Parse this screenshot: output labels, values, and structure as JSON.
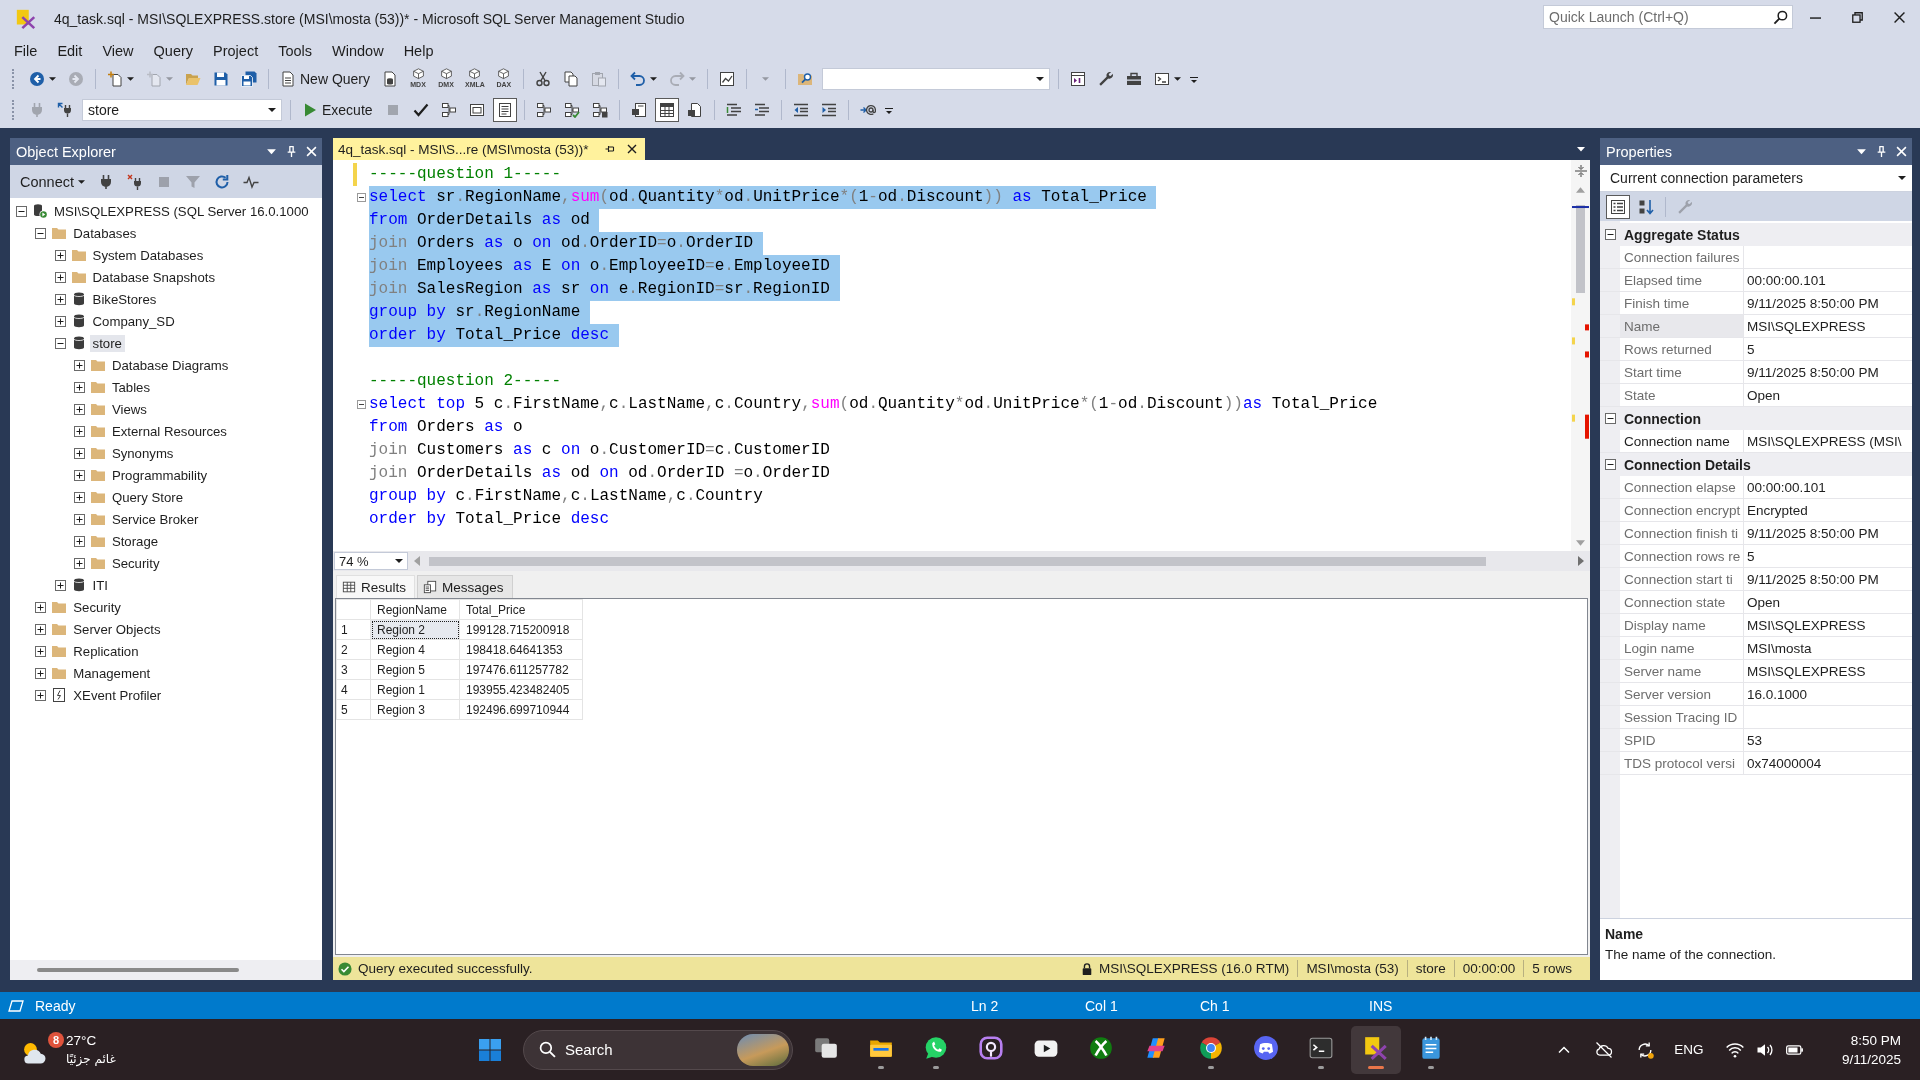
{
  "window": {
    "title": "4q_task.sql - MSI\\SQLEXPRESS.store (MSI\\mosta (53))* - Microsoft SQL Server Management Studio",
    "quick_launch": {
      "placeholder": "Quick Launch (Ctrl+Q)"
    }
  },
  "menu": [
    "File",
    "Edit",
    "View",
    "Query",
    "Project",
    "Tools",
    "Window",
    "Help"
  ],
  "toolbars": [
    {
      "items": [
        {
          "kind": "back",
          "disabled": false,
          "dropdown": true
        },
        {
          "kind": "forward",
          "disabled": true
        },
        {
          "kind": "separator"
        },
        {
          "kind": "newproject",
          "disabled": false,
          "dropdown": true
        },
        {
          "kind": "additem",
          "disabled": true,
          "dropdown": true
        },
        {
          "kind": "open",
          "disabled": false
        },
        {
          "kind": "save",
          "disabled": false
        },
        {
          "kind": "saveall",
          "disabled": false
        },
        {
          "kind": "separator"
        },
        {
          "kind": "newquery",
          "label": "New Query",
          "disabled": false
        },
        {
          "kind": "dbquery",
          "disabled": false
        },
        {
          "kind": "cubequery",
          "label": "MDX",
          "disabled": false
        },
        {
          "kind": "cubequery",
          "label": "DMX",
          "disabled": false
        },
        {
          "kind": "cubequery",
          "label": "XMLA",
          "disabled": false
        },
        {
          "kind": "cubequery",
          "label": "DAX",
          "disabled": false
        },
        {
          "kind": "separator"
        },
        {
          "kind": "cut",
          "disabled": false
        },
        {
          "kind": "copy",
          "disabled": false
        },
        {
          "kind": "paste",
          "disabled": true
        },
        {
          "kind": "separator"
        },
        {
          "kind": "undo",
          "disabled": false,
          "dropdown": true
        },
        {
          "kind": "redo",
          "disabled": true,
          "dropdown": true
        },
        {
          "kind": "separator"
        },
        {
          "kind": "monitor",
          "disabled": false
        },
        {
          "kind": "separator"
        },
        {
          "kind": "menu",
          "disabled": true,
          "dropdown": true
        },
        {
          "kind": "separator"
        },
        {
          "kind": "find",
          "disabled": false
        },
        {
          "kind": "combo"
        },
        {
          "kind": "separator"
        },
        {
          "kind": "solution",
          "disabled": false
        },
        {
          "kind": "wrench",
          "disabled": false
        },
        {
          "kind": "toolbox",
          "disabled": false
        },
        {
          "kind": "terminal",
          "disabled": false,
          "dropdown": true
        }
      ]
    },
    {
      "items": [
        {
          "kind": "plug",
          "disabled": true
        },
        {
          "kind": "connect",
          "disabled": false
        },
        {
          "kind": "combo",
          "value": "store"
        },
        {
          "kind": "separator"
        },
        {
          "kind": "execute",
          "label": "Execute",
          "disabled": false
        },
        {
          "kind": "stop",
          "disabled": true
        },
        {
          "kind": "parse",
          "disabled": false
        },
        {
          "kind": "boxes",
          "disabled": false,
          "pressed": false
        },
        {
          "kind": "window",
          "disabled": false,
          "pressed": false
        },
        {
          "kind": "page",
          "disabled": false,
          "pressed": true
        },
        {
          "kind": "separator"
        },
        {
          "kind": "boxes",
          "disabled": false,
          "pressed": false
        },
        {
          "kind": "boxescheck",
          "disabled": false,
          "pressed": false
        },
        {
          "kind": "boxesdoc",
          "disabled": false,
          "pressed": false
        },
        {
          "kind": "separator"
        },
        {
          "kind": "textdoc",
          "disabled": false,
          "pressed": false
        },
        {
          "kind": "grid",
          "disabled": false,
          "pressed": true
        },
        {
          "kind": "filedoc",
          "disabled": false,
          "pressed": false
        },
        {
          "kind": "separator"
        },
        {
          "kind": "lines",
          "disabled": false
        },
        {
          "kind": "lines2",
          "disabled": false
        },
        {
          "kind": "separator"
        },
        {
          "kind": "outdent",
          "disabled": false
        },
        {
          "kind": "indent",
          "disabled": false
        },
        {
          "kind": "separator"
        },
        {
          "kind": "at",
          "disabled": false
        }
      ]
    }
  ],
  "object_explorer": {
    "title": "Object Explorer",
    "toolbar": [
      {
        "kind": "connectmenu",
        "label": "Connect",
        "disabled": false,
        "dropdown": true
      },
      {
        "kind": "plug",
        "disabled": false
      },
      {
        "kind": "disconnect",
        "disabled": false
      },
      {
        "kind": "stop",
        "disabled": true
      },
      {
        "kind": "filter",
        "disabled": true
      },
      {
        "kind": "refresh",
        "disabled": false
      },
      {
        "kind": "pulse",
        "disabled": false
      }
    ],
    "tree": [
      {
        "label": "MSI\\SQLEXPRESS (SQL Server 16.0.1000",
        "kind": "server",
        "expanded": true,
        "selected": false,
        "children": [
          {
            "label": "Databases",
            "kind": "folder",
            "expanded": true,
            "selected": false,
            "children": [
              {
                "label": "System Databases",
                "kind": "folder",
                "expanded": false,
                "selected": false
              },
              {
                "label": "Database Snapshots",
                "kind": "folder",
                "expanded": false,
                "selected": false
              },
              {
                "label": "BikeStores",
                "kind": "database",
                "expanded": false,
                "selected": false
              },
              {
                "label": "Company_SD",
                "kind": "database",
                "expanded": false,
                "selected": false
              },
              {
                "label": "store",
                "kind": "database",
                "expanded": true,
                "selected": true,
                "children": [
                  {
                    "label": "Database Diagrams",
                    "kind": "folder",
                    "expanded": false,
                    "selected": false
                  },
                  {
                    "label": "Tables",
                    "kind": "folder",
                    "expanded": false,
                    "selected": false
                  },
                  {
                    "label": "Views",
                    "kind": "folder",
                    "expanded": false,
                    "selected": false
                  },
                  {
                    "label": "External Resources",
                    "kind": "folder",
                    "expanded": false,
                    "selected": false
                  },
                  {
                    "label": "Synonyms",
                    "kind": "folder",
                    "expanded": false,
                    "selected": false
                  },
                  {
                    "label": "Programmability",
                    "kind": "folder",
                    "expanded": false,
                    "selected": false
                  },
                  {
                    "label": "Query Store",
                    "kind": "folder",
                    "expanded": false,
                    "selected": false
                  },
                  {
                    "label": "Service Broker",
                    "kind": "folder",
                    "expanded": false,
                    "selected": false
                  },
                  {
                    "label": "Storage",
                    "kind": "folder",
                    "expanded": false,
                    "selected": false
                  },
                  {
                    "label": "Security",
                    "kind": "folder",
                    "expanded": false,
                    "selected": false
                  }
                ]
              },
              {
                "label": "ITI",
                "kind": "database",
                "expanded": false,
                "selected": false
              }
            ]
          },
          {
            "label": "Security",
            "kind": "folder",
            "expanded": false,
            "selected": false
          },
          {
            "label": "Server Objects",
            "kind": "folder",
            "expanded": false,
            "selected": false
          },
          {
            "label": "Replication",
            "kind": "folder",
            "expanded": false,
            "selected": false
          },
          {
            "label": "Management",
            "kind": "folder",
            "expanded": false,
            "selected": false
          },
          {
            "label": "XEvent Profiler",
            "kind": "profiler",
            "expanded": false,
            "selected": false
          }
        ]
      }
    ]
  },
  "editor": {
    "tabs": [
      {
        "title": "4q_task.sql - MSI\\S...re (MSI\\mosta (53))*",
        "selected": true
      }
    ],
    "lines": [
      {
        "changed": true,
        "fold": false,
        "selected": false,
        "tokens": [
          {
            "kind": "comment",
            "text": "-----question 1-----"
          }
        ]
      },
      {
        "changed": false,
        "fold": true,
        "selected": true,
        "tokens": [
          {
            "kind": "keyword",
            "text": "select"
          },
          {
            "kind": "text",
            "text": " sr"
          },
          {
            "kind": "operator",
            "text": "."
          },
          {
            "kind": "text",
            "text": "RegionName"
          },
          {
            "kind": "operator",
            "text": ","
          },
          {
            "kind": "function",
            "text": "sum"
          },
          {
            "kind": "operator",
            "text": "("
          },
          {
            "kind": "text",
            "text": "od"
          },
          {
            "kind": "operator",
            "text": "."
          },
          {
            "kind": "text",
            "text": "Quantity"
          },
          {
            "kind": "operator",
            "text": "*"
          },
          {
            "kind": "text",
            "text": "od"
          },
          {
            "kind": "operator",
            "text": "."
          },
          {
            "kind": "text",
            "text": "UnitPrice"
          },
          {
            "kind": "operator",
            "text": "*("
          },
          {
            "kind": "text",
            "text": "1"
          },
          {
            "kind": "operator",
            "text": "-"
          },
          {
            "kind": "text",
            "text": "od"
          },
          {
            "kind": "operator",
            "text": "."
          },
          {
            "kind": "text",
            "text": "Discount"
          },
          {
            "kind": "operator",
            "text": ")) "
          },
          {
            "kind": "keyword",
            "text": "as"
          },
          {
            "kind": "text",
            "text": " Total_Price"
          }
        ]
      },
      {
        "changed": false,
        "fold": false,
        "selected": true,
        "tokens": [
          {
            "kind": "keyword",
            "text": "from"
          },
          {
            "kind": "text",
            "text": " OrderDetails "
          },
          {
            "kind": "keyword",
            "text": "as"
          },
          {
            "kind": "text",
            "text": " od"
          }
        ]
      },
      {
        "changed": false,
        "fold": false,
        "selected": true,
        "tokens": [
          {
            "kind": "operator",
            "text": "join"
          },
          {
            "kind": "text",
            "text": " Orders "
          },
          {
            "kind": "keyword",
            "text": "as"
          },
          {
            "kind": "text",
            "text": " o "
          },
          {
            "kind": "keyword",
            "text": "on"
          },
          {
            "kind": "text",
            "text": " od"
          },
          {
            "kind": "operator",
            "text": "."
          },
          {
            "kind": "text",
            "text": "OrderID"
          },
          {
            "kind": "operator",
            "text": "="
          },
          {
            "kind": "text",
            "text": "o"
          },
          {
            "kind": "operator",
            "text": "."
          },
          {
            "kind": "text",
            "text": "OrderID"
          }
        ]
      },
      {
        "changed": false,
        "fold": false,
        "selected": true,
        "tokens": [
          {
            "kind": "operator",
            "text": "join"
          },
          {
            "kind": "text",
            "text": " Employees "
          },
          {
            "kind": "keyword",
            "text": "as"
          },
          {
            "kind": "text",
            "text": " E "
          },
          {
            "kind": "keyword",
            "text": "on"
          },
          {
            "kind": "text",
            "text": " o"
          },
          {
            "kind": "operator",
            "text": "."
          },
          {
            "kind": "text",
            "text": "EmployeeID"
          },
          {
            "kind": "operator",
            "text": "="
          },
          {
            "kind": "text",
            "text": "e"
          },
          {
            "kind": "operator",
            "text": "."
          },
          {
            "kind": "text",
            "text": "EmployeeID"
          }
        ]
      },
      {
        "changed": false,
        "fold": false,
        "selected": true,
        "tokens": [
          {
            "kind": "operator",
            "text": "join"
          },
          {
            "kind": "text",
            "text": " SalesRegion "
          },
          {
            "kind": "keyword",
            "text": "as"
          },
          {
            "kind": "text",
            "text": " sr "
          },
          {
            "kind": "keyword",
            "text": "on"
          },
          {
            "kind": "text",
            "text": " e"
          },
          {
            "kind": "operator",
            "text": "."
          },
          {
            "kind": "text",
            "text": "RegionID"
          },
          {
            "kind": "operator",
            "text": "="
          },
          {
            "kind": "text",
            "text": "sr"
          },
          {
            "kind": "operator",
            "text": "."
          },
          {
            "kind": "text",
            "text": "RegionID"
          }
        ]
      },
      {
        "changed": false,
        "fold": false,
        "selected": true,
        "tokens": [
          {
            "kind": "keyword",
            "text": "group by"
          },
          {
            "kind": "text",
            "text": " sr"
          },
          {
            "kind": "operator",
            "text": "."
          },
          {
            "kind": "text",
            "text": "RegionName"
          }
        ]
      },
      {
        "changed": false,
        "fold": false,
        "selected": true,
        "tokens": [
          {
            "kind": "keyword",
            "text": "order by"
          },
          {
            "kind": "text",
            "text": " Total_Price "
          },
          {
            "kind": "keyword",
            "text": "desc"
          }
        ]
      },
      {
        "changed": false,
        "fold": false,
        "selected": false
      },
      {
        "changed": false,
        "fold": false,
        "selected": false,
        "tokens": [
          {
            "kind": "comment",
            "text": "-----question 2-----"
          }
        ]
      },
      {
        "changed": false,
        "fold": true,
        "selected": false,
        "tokens": [
          {
            "kind": "keyword",
            "text": "select top"
          },
          {
            "kind": "text",
            "text": " 5 c"
          },
          {
            "kind": "operator",
            "text": "."
          },
          {
            "kind": "text",
            "text": "FirstName"
          },
          {
            "kind": "operator",
            "text": ","
          },
          {
            "kind": "text",
            "text": "c"
          },
          {
            "kind": "operator",
            "text": "."
          },
          {
            "kind": "text",
            "text": "LastName"
          },
          {
            "kind": "operator",
            "text": ","
          },
          {
            "kind": "text",
            "text": "c"
          },
          {
            "kind": "operator",
            "text": "."
          },
          {
            "kind": "text",
            "text": "Country"
          },
          {
            "kind": "operator",
            "text": ","
          },
          {
            "kind": "function",
            "text": "sum"
          },
          {
            "kind": "operator",
            "text": "("
          },
          {
            "kind": "text",
            "text": "od"
          },
          {
            "kind": "operator",
            "text": "."
          },
          {
            "kind": "text",
            "text": "Quantity"
          },
          {
            "kind": "operator",
            "text": "*"
          },
          {
            "kind": "text",
            "text": "od"
          },
          {
            "kind": "operator",
            "text": "."
          },
          {
            "kind": "text",
            "text": "UnitPrice"
          },
          {
            "kind": "operator",
            "text": "*("
          },
          {
            "kind": "text",
            "text": "1"
          },
          {
            "kind": "operator",
            "text": "-"
          },
          {
            "kind": "text",
            "text": "od"
          },
          {
            "kind": "operator",
            "text": "."
          },
          {
            "kind": "text",
            "text": "Discount"
          },
          {
            "kind": "operator",
            "text": "))"
          },
          {
            "kind": "keyword",
            "text": "as"
          },
          {
            "kind": "text",
            "text": " Total_Price"
          }
        ]
      },
      {
        "changed": false,
        "fold": false,
        "selected": false,
        "tokens": [
          {
            "kind": "keyword",
            "text": "from"
          },
          {
            "kind": "text",
            "text": " Orders "
          },
          {
            "kind": "keyword",
            "text": "as"
          },
          {
            "kind": "text",
            "text": " o"
          }
        ]
      },
      {
        "changed": false,
        "fold": false,
        "selected": false,
        "tokens": [
          {
            "kind": "operator",
            "text": "join"
          },
          {
            "kind": "text",
            "text": " Customers "
          },
          {
            "kind": "keyword",
            "text": "as"
          },
          {
            "kind": "text",
            "text": " c "
          },
          {
            "kind": "keyword",
            "text": "on"
          },
          {
            "kind": "text",
            "text": " o"
          },
          {
            "kind": "operator",
            "text": "."
          },
          {
            "kind": "text",
            "text": "CustomerID"
          },
          {
            "kind": "operator",
            "text": "="
          },
          {
            "kind": "text",
            "text": "c"
          },
          {
            "kind": "operator",
            "text": "."
          },
          {
            "kind": "text",
            "text": "CustomerID"
          }
        ]
      },
      {
        "changed": false,
        "fold": false,
        "selected": false,
        "tokens": [
          {
            "kind": "operator",
            "text": "join"
          },
          {
            "kind": "text",
            "text": " OrderDetails "
          },
          {
            "kind": "keyword",
            "text": "as"
          },
          {
            "kind": "text",
            "text": " od "
          },
          {
            "kind": "keyword",
            "text": "on"
          },
          {
            "kind": "text",
            "text": " od"
          },
          {
            "kind": "operator",
            "text": "."
          },
          {
            "kind": "text",
            "text": "OrderID "
          },
          {
            "kind": "operator",
            "text": "="
          },
          {
            "kind": "text",
            "text": "o"
          },
          {
            "kind": "operator",
            "text": "."
          },
          {
            "kind": "text",
            "text": "OrderID"
          }
        ]
      },
      {
        "changed": false,
        "fold": false,
        "selected": false,
        "tokens": [
          {
            "kind": "keyword",
            "text": "group by"
          },
          {
            "kind": "text",
            "text": " c"
          },
          {
            "kind": "operator",
            "text": "."
          },
          {
            "kind": "text",
            "text": "FirstName"
          },
          {
            "kind": "operator",
            "text": ","
          },
          {
            "kind": "text",
            "text": "c"
          },
          {
            "kind": "operator",
            "text": "."
          },
          {
            "kind": "text",
            "text": "LastName"
          },
          {
            "kind": "operator",
            "text": ","
          },
          {
            "kind": "text",
            "text": "c"
          },
          {
            "kind": "operator",
            "text": "."
          },
          {
            "kind": "text",
            "text": "Country"
          }
        ]
      },
      {
        "changed": false,
        "fold": false,
        "selected": false,
        "tokens": [
          {
            "kind": "keyword",
            "text": "order by"
          },
          {
            "kind": "text",
            "text": " Total_Price "
          },
          {
            "kind": "keyword",
            "text": "desc"
          }
        ]
      }
    ],
    "zoom": "74 %"
  },
  "results": {
    "tabs": [
      {
        "label": "Results",
        "kind": "grid",
        "selected": true
      },
      {
        "label": "Messages",
        "kind": "messages",
        "selected": false
      }
    ],
    "columns": [
      "RegionName",
      "Total_Price"
    ],
    "rows": [
      {
        "number": "1",
        "cells": [
          {
            "text": "Region 2",
            "selected": true
          },
          {
            "text": "199128.715200918",
            "selected": false
          }
        ]
      },
      {
        "number": "2",
        "cells": [
          {
            "text": "Region 4",
            "selected": false
          },
          {
            "text": "198418.64641353",
            "selected": false
          }
        ]
      },
      {
        "number": "3",
        "cells": [
          {
            "text": "Region 5",
            "selected": false
          },
          {
            "text": "197476.611257782",
            "selected": false
          }
        ]
      },
      {
        "number": "4",
        "cells": [
          {
            "text": "Region 1",
            "selected": false
          },
          {
            "text": "193955.423482405",
            "selected": false
          }
        ]
      },
      {
        "number": "5",
        "cells": [
          {
            "text": "Region 3",
            "selected": false
          },
          {
            "text": "192496.699710944",
            "selected": false
          }
        ]
      }
    ]
  },
  "query_status": {
    "message": "Query executed successfully.",
    "server": "MSI\\SQLEXPRESS (16.0 RTM)",
    "login": "MSI\\mosta (53)",
    "database": "store",
    "elapsed": "00:00:00",
    "rows": "5 rows"
  },
  "properties": {
    "title": "Properties",
    "object": "Current connection parameters",
    "toolbar": [
      {
        "kind": "categorized",
        "disabled": false,
        "pressed": true
      },
      {
        "kind": "alphabetical",
        "disabled": false,
        "pressed": false
      },
      {
        "kind": "separator"
      },
      {
        "kind": "pages",
        "disabled": true,
        "pressed": false
      }
    ],
    "categories": [
      {
        "name": "Aggregate Status",
        "expanded": true,
        "rows": [
          {
            "label": "Connection failures",
            "readonly": true,
            "selected": false
          },
          {
            "label": "Elapsed time",
            "value": "00:00:00.101",
            "readonly": true,
            "selected": false
          },
          {
            "label": "Finish time",
            "value": "9/11/2025 8:50:00 PM",
            "readonly": true,
            "selected": false
          },
          {
            "label": "Name",
            "value": "MSI\\SQLEXPRESS",
            "readonly": true,
            "selected": true
          },
          {
            "label": "Rows returned",
            "value": "5",
            "readonly": true,
            "selected": false
          },
          {
            "label": "Start time",
            "value": "9/11/2025 8:50:00 PM",
            "readonly": true,
            "selected": false
          },
          {
            "label": "State",
            "value": "Open",
            "readonly": true,
            "selected": false
          }
        ]
      },
      {
        "name": "Connection",
        "expanded": true,
        "rows": [
          {
            "label": "Connection name",
            "value": "MSI\\SQLEXPRESS (MSI\\",
            "readonly": false,
            "selected": false
          }
        ]
      },
      {
        "name": "Connection Details",
        "expanded": true,
        "rows": [
          {
            "label": "Connection elapse",
            "value": "00:00:00.101",
            "readonly": true,
            "selected": false
          },
          {
            "label": "Connection encrypt",
            "value": "Encrypted",
            "readonly": true,
            "selected": false
          },
          {
            "label": "Connection finish ti",
            "value": "9/11/2025 8:50:00 PM",
            "readonly": true,
            "selected": false
          },
          {
            "label": "Connection rows re",
            "value": "5",
            "readonly": true,
            "selected": false
          },
          {
            "label": "Connection start ti",
            "value": "9/11/2025 8:50:00 PM",
            "readonly": true,
            "selected": false
          },
          {
            "label": "Connection state",
            "value": "Open",
            "readonly": true,
            "selected": false
          },
          {
            "label": "Display name",
            "value": "MSI\\SQLEXPRESS",
            "readonly": true,
            "selected": false
          },
          {
            "label": "Login name",
            "value": "MSI\\mosta",
            "readonly": true,
            "selected": false
          },
          {
            "label": "Server name",
            "value": "MSI\\SQLEXPRESS",
            "readonly": true,
            "selected": false
          },
          {
            "label": "Server version",
            "value": "16.0.1000",
            "readonly": true,
            "selected": false
          },
          {
            "label": "Session Tracing ID",
            "readonly": true,
            "selected": false
          },
          {
            "label": "SPID",
            "value": "53",
            "readonly": true,
            "selected": false
          },
          {
            "label": "TDS protocol versi",
            "value": "0x74000004",
            "readonly": true,
            "selected": false
          }
        ]
      }
    ],
    "description": {
      "title": "Name",
      "text": "The name of the connection."
    }
  },
  "status_bar": {
    "message": "Ready",
    "line": "Ln 2",
    "column": "Col 1",
    "character": "Ch 1",
    "mode": "INS"
  },
  "taskbar": {
    "weather": {
      "badge": "8",
      "temperature": "27°C",
      "condition": "غائم جزئيًا"
    },
    "search": {
      "placeholder": "Search"
    },
    "apps": [
      {
        "kind": "taskview",
        "running": false,
        "selected": false
      },
      {
        "kind": "folder",
        "running": true,
        "selected": false
      },
      {
        "kind": "chat",
        "running": true,
        "selected": false
      },
      {
        "kind": "ring",
        "running": false,
        "selected": false
      },
      {
        "kind": "video",
        "running": false,
        "selected": false
      },
      {
        "kind": "xsphere",
        "running": false,
        "selected": false
      },
      {
        "kind": "swirl",
        "running": false,
        "selected": false
      },
      {
        "kind": "browser",
        "running": true,
        "selected": false
      },
      {
        "kind": "gamepad",
        "running": false,
        "selected": false
      },
      {
        "kind": "terminal",
        "running": true,
        "selected": false
      },
      {
        "kind": "tools",
        "running": true,
        "selected": true
      },
      {
        "kind": "notepad",
        "running": true,
        "selected": false
      }
    ],
    "tray": {
      "language": "ENG",
      "time": "8:50 PM",
      "date": "9/11/2025"
    }
  }
}
